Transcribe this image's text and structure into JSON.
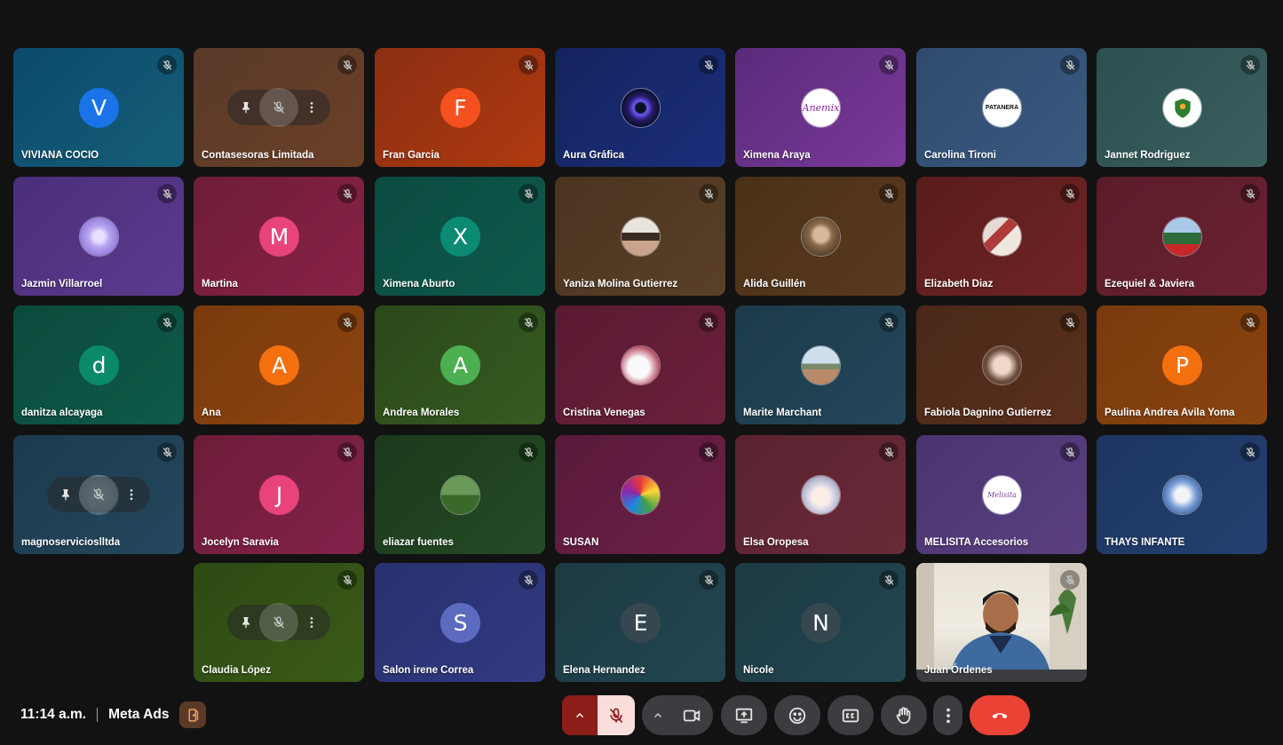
{
  "participants": [
    {
      "name": "VIVIANA COCIO",
      "type": "letter",
      "initial": "V",
      "bg": [
        "#0c4a6e",
        "#155e75"
      ],
      "avatar_color": "#1a73e8"
    },
    {
      "name": "Contasesoras Limitada",
      "type": "hover",
      "bg": [
        "#5a3a2a",
        "#6b3f26"
      ]
    },
    {
      "name": "Fran Garcia",
      "type": "letter",
      "initial": "F",
      "bg": [
        "#8a2e12",
        "#b03a10"
      ],
      "avatar_color": "#f4511e"
    },
    {
      "name": "Aura Gráfica",
      "type": "photo",
      "photo": "aura",
      "bg": [
        "#14235e",
        "#1b2e7a"
      ]
    },
    {
      "name": "Ximena Araya",
      "type": "photo",
      "photo": "anemix",
      "bg": [
        "#5b2a7a",
        "#7a3a9a"
      ]
    },
    {
      "name": "Carolina Tironi",
      "type": "photo",
      "photo": "patanera",
      "bg": [
        "#2f4a6e",
        "#3a5a80"
      ]
    },
    {
      "name": "Jannet Rodriguez",
      "type": "photo",
      "photo": "nahuen",
      "bg": [
        "#2c4f4f",
        "#3a6060"
      ]
    },
    {
      "name": "Jazmin Villarroel",
      "type": "photo",
      "photo": "dandelion",
      "bg": [
        "#4a2f7a",
        "#5c3a8e"
      ]
    },
    {
      "name": "Martina",
      "type": "letter",
      "initial": "M",
      "bg": [
        "#6e1c3a",
        "#8a2248"
      ],
      "avatar_color": "#e8437a"
    },
    {
      "name": "Ximena Aburto",
      "type": "letter",
      "initial": "X",
      "bg": [
        "#0b4a40",
        "#0f5a4c"
      ],
      "avatar_color": "#0b8a74"
    },
    {
      "name": "Yaniza Molina Gutierrez",
      "type": "photo",
      "photo": "woman1",
      "bg": [
        "#4a3420",
        "#5a4028"
      ]
    },
    {
      "name": "Alida Guillén",
      "type": "photo",
      "photo": "woman2",
      "bg": [
        "#4a3018",
        "#5a3a1e"
      ]
    },
    {
      "name": "Elizabeth Diaz",
      "type": "photo",
      "photo": "group",
      "bg": [
        "#5a1c1c",
        "#6e2424"
      ]
    },
    {
      "name": "Ezequiel & Javiera",
      "type": "photo",
      "photo": "couple",
      "bg": [
        "#5a1c2a",
        "#6a2232"
      ]
    },
    {
      "name": "danitza alcayaga",
      "type": "letter",
      "initial": "d",
      "bg": [
        "#0b4a3c",
        "#0f5a48"
      ],
      "avatar_color": "#0b8a6a"
    },
    {
      "name": "Ana",
      "type": "letter",
      "initial": "A",
      "bg": [
        "#7a3a0c",
        "#8e4410"
      ],
      "avatar_color": "#f4700e"
    },
    {
      "name": "Andrea Morales",
      "type": "letter",
      "initial": "A",
      "bg": [
        "#2a4a1a",
        "#365a20"
      ],
      "avatar_color": "#4caf50"
    },
    {
      "name": "Cristina Venegas",
      "type": "photo",
      "photo": "dog",
      "bg": [
        "#5a1a32",
        "#6a203c"
      ]
    },
    {
      "name": "Marite Marchant",
      "type": "photo",
      "photo": "woman3",
      "bg": [
        "#1c3a4a",
        "#24475a"
      ]
    },
    {
      "name": "Fabiola Dagnino Gutierrez",
      "type": "photo",
      "photo": "woman4",
      "bg": [
        "#4a2818",
        "#5a301c"
      ]
    },
    {
      "name": "Paulina Andrea Avila Yoma",
      "type": "letter",
      "initial": "P",
      "bg": [
        "#7a3a0c",
        "#8a4410"
      ],
      "avatar_color": "#f4700e"
    },
    {
      "name": "magnoservicioslltda",
      "type": "hover-photo",
      "bg": [
        "#1c3a4e",
        "#24485e"
      ]
    },
    {
      "name": "Jocelyn Saravia",
      "type": "letter",
      "initial": "J",
      "bg": [
        "#6e1c3a",
        "#82224a"
      ],
      "avatar_color": "#e8437a"
    },
    {
      "name": "eliazar fuentes",
      "type": "photo",
      "photo": "park",
      "bg": [
        "#1c3a1c",
        "#244a24"
      ]
    },
    {
      "name": "SUSAN",
      "type": "photo",
      "photo": "lion",
      "bg": [
        "#5a1a3a",
        "#6a2046"
      ]
    },
    {
      "name": "Elsa Oropesa",
      "type": "photo",
      "photo": "anime",
      "bg": [
        "#5a2230",
        "#6a2a38"
      ]
    },
    {
      "name": "MELISITA Accesorios",
      "type": "photo",
      "photo": "melisita",
      "bg": [
        "#4a3470",
        "#5a4080"
      ]
    },
    {
      "name": "THAYS INFANTE",
      "type": "photo",
      "photo": "angel",
      "bg": [
        "#1c3560",
        "#244070"
      ]
    },
    {
      "name": "Claudia López",
      "type": "hover",
      "bg": [
        "#2e4a14",
        "#3a5a18"
      ]
    },
    {
      "name": "Salon irene Correa",
      "type": "letter",
      "initial": "S",
      "bg": [
        "#28306e",
        "#323a82"
      ],
      "avatar_color": "#5c6bc0"
    },
    {
      "name": "Elena Hernandez",
      "type": "letter",
      "initial": "E",
      "bg": [
        "#1c3a44",
        "#224650"
      ],
      "avatar_color": "#37474f"
    },
    {
      "name": "Nicole",
      "type": "letter",
      "initial": "N",
      "bg": [
        "#1c3a44",
        "#224650"
      ],
      "avatar_color": "#37474f"
    },
    {
      "name": "Juan Órdenes",
      "type": "video",
      "bg": [
        "#3c3d40",
        "#3c3d40"
      ]
    }
  ],
  "meeting": {
    "time": "11:14 a.m.",
    "title": "Meta Ads"
  },
  "controls": {
    "mic_state": "muted",
    "hangup_color": "#ea4335"
  }
}
